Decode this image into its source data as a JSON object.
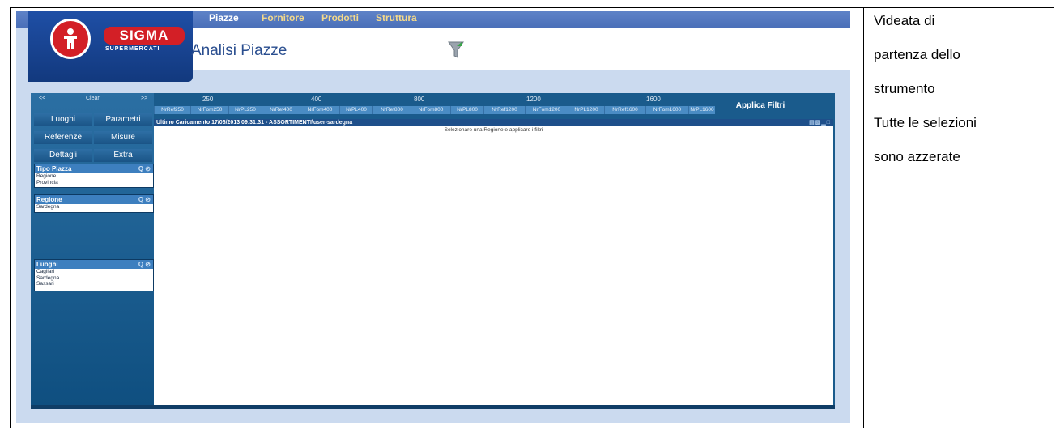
{
  "nav": {
    "tabs": [
      "Piazze",
      "Fornitore",
      "Prodotti",
      "Struttura"
    ]
  },
  "header": {
    "brand": "SIGMA",
    "brand_sub": "SUPERMERCATI",
    "page_title": "Analisi Piazze"
  },
  "sidebar": {
    "prev": "<<",
    "clear": "Clear",
    "next": ">>",
    "buttons": [
      "Luoghi",
      "Parametri",
      "Referenze",
      "Misure",
      "Dettagli",
      "Extra"
    ],
    "filters": [
      {
        "title": "Tipo Piazza",
        "items": [
          "Regione",
          "Provincia"
        ]
      },
      {
        "title": "Regione",
        "items": [
          "Sardegna"
        ]
      },
      {
        "title": "Luoghi",
        "items": [
          "Cagliari",
          "Sardegna",
          "Sassari"
        ]
      }
    ]
  },
  "toolbar": {
    "groups": [
      "250",
      "400",
      "800",
      "1200",
      "1600"
    ],
    "columns": [
      "NrRef250",
      "NrFom250",
      "NrPL250",
      "NrRef400",
      "NrFom400",
      "NrPL400",
      "NrRef800",
      "NrFom800",
      "NrPL800",
      "NrRef1200",
      "NrFom1200",
      "NrPL1200",
      "NrRef1600",
      "NrFom1600",
      "NrPL1600"
    ],
    "apply": "Applica Filtri"
  },
  "info_bar": "Ultimo Caricamento 17/06/2013 09:31:31 - ASSORTIMENTI\\user-sardegna",
  "content_message": "Selezionare una Regione e applicare i filtri",
  "notes": [
    "Videata di",
    "partenza dello",
    "strumento",
    "Tutte le selezioni",
    "sono azzerate"
  ],
  "colors": {
    "brand_red": "#d31f26",
    "nav_blue": "#4a6fb8",
    "panel_blue": "#1a5b8c",
    "column_blue": "#4a8cc4"
  }
}
